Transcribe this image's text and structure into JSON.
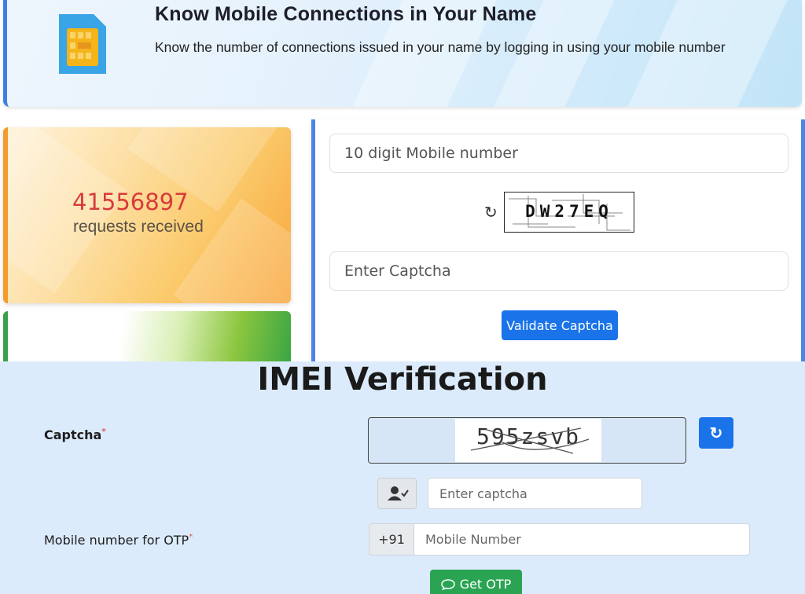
{
  "banner": {
    "title": "Know Mobile Connections in Your Name",
    "description": "Know the number of connections issued in your name by logging in using your mobile number",
    "accent_color": "#3d7fe6"
  },
  "stats": {
    "requests_count": "41556897",
    "requests_label": "requests received",
    "count_color": "#d83a3a"
  },
  "login_form": {
    "mobile_placeholder": "10 digit Mobile number",
    "captcha_code": "DW27EQ",
    "captcha_placeholder": "Enter Captcha",
    "validate_label": "Validate Captcha",
    "button_color": "#1a73e8"
  },
  "imei": {
    "title": "IMEI Verification",
    "captcha_label": "Captcha",
    "required_mark": "*",
    "captcha_code": "595zsvb",
    "captcha_input_placeholder": "Enter captcha",
    "mobile_label": "Mobile number for OTP",
    "country_code": "+91",
    "mobile_placeholder": "Mobile Number",
    "otp_label": "Get OTP",
    "otp_color": "#2aa453",
    "background": "#dcebfb"
  },
  "icons": {
    "sim": "sim-card-icon",
    "refresh": "refresh-icon",
    "user_check": "user-check-icon",
    "chat": "chat-bubble-icon"
  }
}
